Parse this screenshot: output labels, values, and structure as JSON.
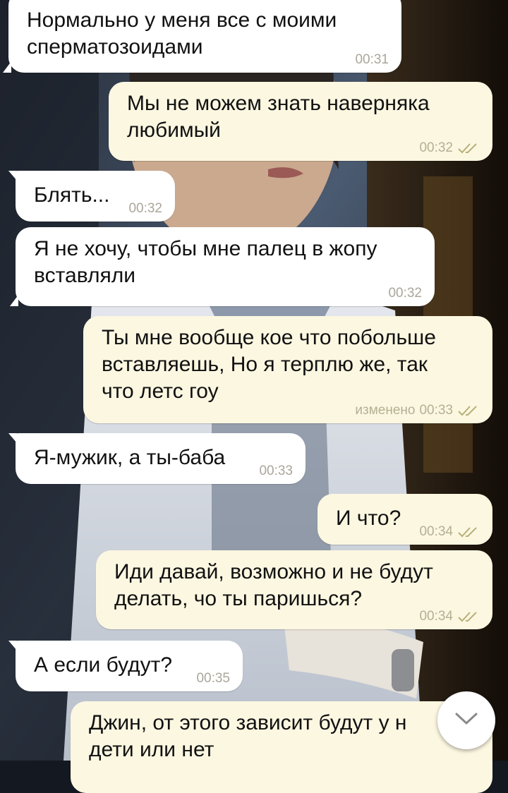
{
  "messages": [
    {
      "id": "m1",
      "direction": "incoming",
      "text": "Нормально у меня все с моими\nсперматозоидами",
      "time": "00:31",
      "edited": "",
      "read": false
    },
    {
      "id": "m2",
      "direction": "outgoing",
      "text": "Мы не можем знать наверняка\nлюбимый",
      "time": "00:32",
      "edited": "",
      "read": true
    },
    {
      "id": "m3",
      "direction": "incoming",
      "text": "Блять...",
      "time": "00:32",
      "edited": "",
      "read": false
    },
    {
      "id": "m4",
      "direction": "incoming",
      "text": "Я не хочу, чтобы мне палец в жопу\nвставляли",
      "time": "00:32",
      "edited": "",
      "read": false
    },
    {
      "id": "m5",
      "direction": "outgoing",
      "text": "Ты мне вообще кое что побольше\nвставляешь, Но я терплю же, так\nчто летс гоу",
      "time": "00:33",
      "edited": "изменено",
      "read": true
    },
    {
      "id": "m6",
      "direction": "incoming",
      "text": "Я-мужик, а ты-баба",
      "time": "00:33",
      "edited": "",
      "read": false
    },
    {
      "id": "m7",
      "direction": "outgoing",
      "text": "И что?",
      "time": "00:34",
      "edited": "",
      "read": true
    },
    {
      "id": "m8",
      "direction": "outgoing",
      "text": "Иди давай, возможно и не будут\nделать, чо ты паришься?",
      "time": "00:34",
      "edited": "",
      "read": true
    },
    {
      "id": "m9",
      "direction": "incoming",
      "text": "А если будут?",
      "time": "00:35",
      "edited": "",
      "read": false
    },
    {
      "id": "m10",
      "direction": "outgoing",
      "text": "Джин, от этого зависит будут у н\nдети или нет",
      "time": "",
      "edited": "",
      "read": true
    }
  ],
  "scroll_button": {
    "icon": "chevron-down-icon"
  },
  "colors": {
    "incoming_bubble": "#ffffff",
    "outgoing_bubble": "#fcf7e1",
    "timestamp": "#aaa69a",
    "read_ticks": "#b8b07a"
  }
}
